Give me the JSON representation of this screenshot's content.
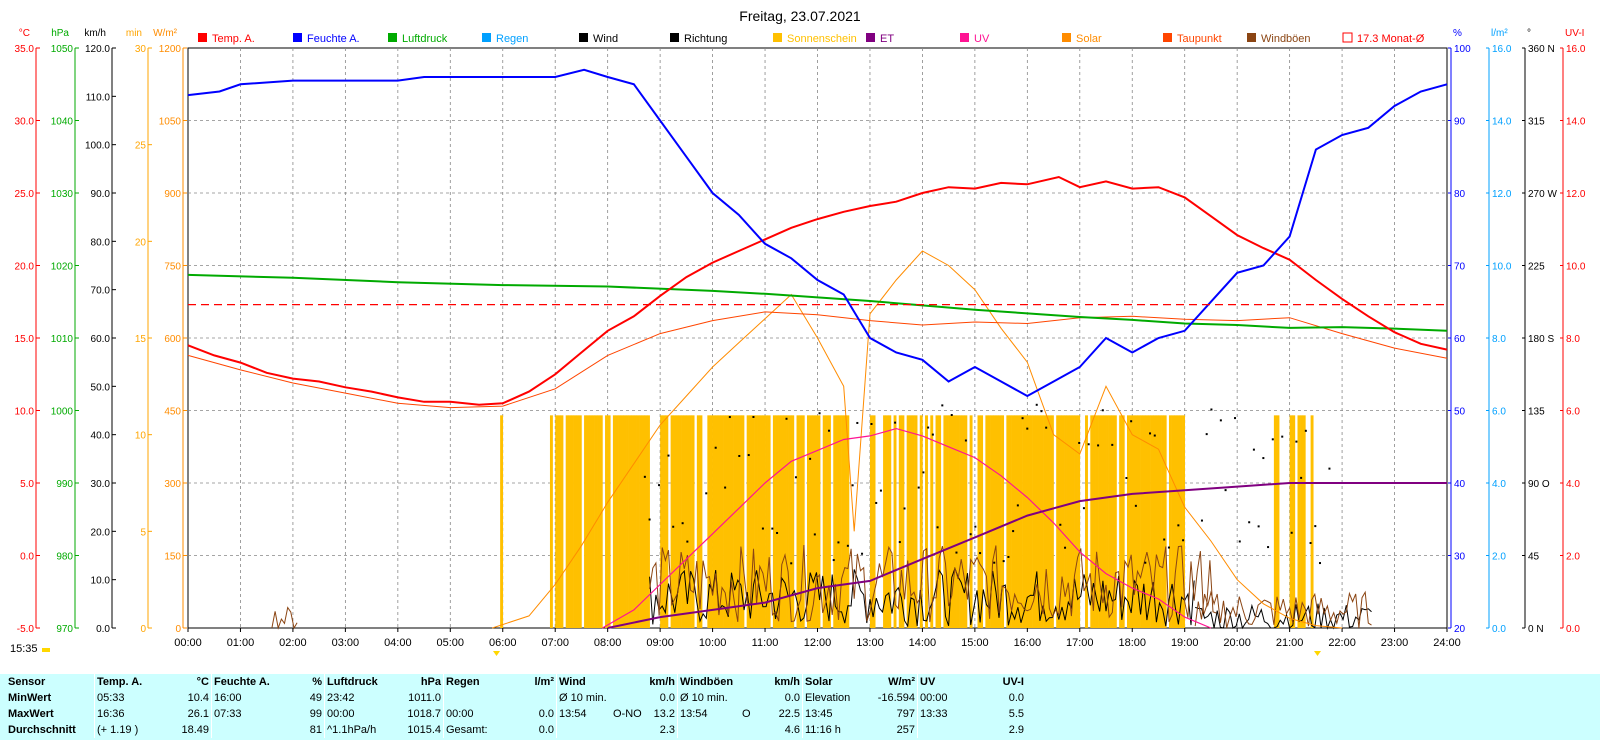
{
  "title": "Freitag, 23.07.2021",
  "current_time": "15:35",
  "legend": [
    {
      "label": "Temp. A.",
      "color": "#ff0000",
      "swatch": "fill"
    },
    {
      "label": "Feuchte A.",
      "color": "#0000ff",
      "swatch": "fill"
    },
    {
      "label": "Luftdruck",
      "color": "#00aa00",
      "swatch": "fill"
    },
    {
      "label": "Regen",
      "color": "#00a0ff",
      "swatch": "fill"
    },
    {
      "label": "Wind",
      "color": "#000000",
      "swatch": "fill"
    },
    {
      "label": "Richtung",
      "color": "#000000",
      "swatch": "fill"
    },
    {
      "label": "Sonnenschein",
      "color": "#ffc000",
      "swatch": "fill"
    },
    {
      "label": "ET",
      "color": "#800080",
      "swatch": "fill"
    },
    {
      "label": "UV",
      "color": "#ff1493",
      "swatch": "fill"
    },
    {
      "label": "Solar",
      "color": "#ff8c00",
      "swatch": "fill"
    },
    {
      "label": "Taupunkt",
      "color": "#ff4500",
      "swatch": "fill"
    },
    {
      "label": "Windböen",
      "color": "#8b4513",
      "swatch": "fill"
    },
    {
      "label": "17.3 Monat-Ø",
      "color": "#ff0000",
      "swatch": "outline"
    }
  ],
  "axes_left": [
    {
      "unit": "°C",
      "color": "#ff0000",
      "ticks": [
        "35.0",
        "30.0",
        "25.0",
        "20.0",
        "15.0",
        "10.0",
        "5.0",
        "0.0",
        "-5.0"
      ]
    },
    {
      "unit": "hPa",
      "color": "#00aa00",
      "ticks": [
        "1050",
        "1040",
        "1030",
        "1020",
        "1010",
        "1000",
        "990",
        "980",
        "970"
      ]
    },
    {
      "unit": "km/h",
      "color": "#000000",
      "ticks": [
        "120.0",
        "110.0",
        "100.0",
        "90.0",
        "80.0",
        "70.0",
        "60.0",
        "50.0",
        "40.0",
        "30.0",
        "20.0",
        "10.0",
        "0.0"
      ]
    },
    {
      "unit": "min",
      "color": "#ffa500",
      "ticks": [
        "30",
        "25",
        "20",
        "15",
        "10",
        "5",
        "0"
      ]
    },
    {
      "unit": "W/m²",
      "color": "#ff8c00",
      "ticks": [
        "1200",
        "1050",
        "900",
        "750",
        "600",
        "450",
        "300",
        "150",
        "0"
      ]
    }
  ],
  "axes_right": [
    {
      "unit": "%",
      "color": "#0000ff",
      "ticks": [
        "100",
        "90",
        "80",
        "70",
        "60",
        "50",
        "40",
        "30",
        "20"
      ]
    },
    {
      "unit": "l/m²",
      "color": "#00a0ff",
      "ticks": [
        "16.0",
        "14.0",
        "12.0",
        "10.0",
        "8.0",
        "6.0",
        "4.0",
        "2.0",
        "0.0"
      ]
    },
    {
      "unit": "°",
      "color": "#000000",
      "ticks": [
        "360 N",
        "315",
        "270 W",
        "225",
        "180 S",
        "135",
        "90 O",
        "45",
        "0 N"
      ]
    },
    {
      "unit": "UV-I",
      "color": "#ff0000",
      "ticks": [
        "16.0",
        "14.0",
        "12.0",
        "10.0",
        "8.0",
        "6.0",
        "4.0",
        "2.0",
        "0.0"
      ]
    }
  ],
  "chart_data": {
    "type": "line",
    "title": "Freitag, 23.07.2021",
    "x_ticks": [
      "00:00",
      "01:00",
      "02:00",
      "03:00",
      "04:00",
      "05:00",
      "06:00",
      "07:00",
      "08:00",
      "09:00",
      "10:00",
      "11:00",
      "12:00",
      "13:00",
      "14:00",
      "15:00",
      "16:00",
      "17:00",
      "18:00",
      "19:00",
      "20:00",
      "21:00",
      "22:00",
      "23:00",
      "24:00"
    ],
    "xlim_hours": [
      0,
      24
    ],
    "grid": true,
    "reference_line": {
      "name": "17.3 Monat-Ø",
      "value": 17.3,
      "unit": "°C",
      "color": "#ff0000"
    },
    "series": [
      {
        "name": "Temp. A.",
        "unit": "°C",
        "ylim": [
          -5,
          35
        ],
        "color": "#ff0000",
        "points": [
          [
            0,
            14.5
          ],
          [
            0.5,
            13.8
          ],
          [
            1,
            13.3
          ],
          [
            1.5,
            12.6
          ],
          [
            2,
            12.2
          ],
          [
            2.5,
            12.0
          ],
          [
            3,
            11.6
          ],
          [
            3.5,
            11.3
          ],
          [
            4,
            10.9
          ],
          [
            4.5,
            10.6
          ],
          [
            5,
            10.6
          ],
          [
            5.55,
            10.4
          ],
          [
            6,
            10.5
          ],
          [
            6.5,
            11.3
          ],
          [
            7,
            12.5
          ],
          [
            7.5,
            14.0
          ],
          [
            8,
            15.5
          ],
          [
            8.5,
            16.5
          ],
          [
            9,
            17.9
          ],
          [
            9.5,
            19.2
          ],
          [
            10,
            20.2
          ],
          [
            10.5,
            21.0
          ],
          [
            11,
            21.8
          ],
          [
            11.5,
            22.6
          ],
          [
            12,
            23.2
          ],
          [
            12.5,
            23.7
          ],
          [
            13,
            24.1
          ],
          [
            13.5,
            24.4
          ],
          [
            14,
            25.0
          ],
          [
            14.5,
            25.4
          ],
          [
            15,
            25.3
          ],
          [
            15.5,
            25.7
          ],
          [
            16,
            25.6
          ],
          [
            16.6,
            26.1
          ],
          [
            17,
            25.4
          ],
          [
            17.5,
            25.8
          ],
          [
            18,
            25.3
          ],
          [
            18.5,
            25.4
          ],
          [
            19,
            24.7
          ],
          [
            19.5,
            23.4
          ],
          [
            20,
            22.1
          ],
          [
            20.5,
            21.2
          ],
          [
            21,
            20.4
          ],
          [
            21.5,
            19.0
          ],
          [
            22,
            17.7
          ],
          [
            22.5,
            16.5
          ],
          [
            23,
            15.4
          ],
          [
            23.5,
            14.6
          ],
          [
            24,
            14.2
          ]
        ]
      },
      {
        "name": "Taupunkt",
        "unit": "°C",
        "ylim": [
          -5,
          35
        ],
        "color": "#ff4500",
        "points": [
          [
            0,
            13.8
          ],
          [
            1,
            12.8
          ],
          [
            2,
            11.9
          ],
          [
            3,
            11.2
          ],
          [
            4,
            10.5
          ],
          [
            5,
            10.2
          ],
          [
            6,
            10.3
          ],
          [
            7,
            11.5
          ],
          [
            8,
            13.8
          ],
          [
            9,
            15.3
          ],
          [
            10,
            16.2
          ],
          [
            11,
            16.8
          ],
          [
            12,
            16.6
          ],
          [
            13,
            16.2
          ],
          [
            14,
            15.9
          ],
          [
            15,
            16.1
          ],
          [
            16,
            16.0
          ],
          [
            17,
            16.4
          ],
          [
            18,
            16.5
          ],
          [
            19,
            16.3
          ],
          [
            20,
            16.2
          ],
          [
            21,
            16.4
          ],
          [
            22,
            15.3
          ],
          [
            23,
            14.3
          ],
          [
            24,
            13.6
          ]
        ]
      },
      {
        "name": "Feuchte A.",
        "unit": "%",
        "ylim": [
          20,
          100
        ],
        "color": "#0000ff",
        "points": [
          [
            0,
            93.5
          ],
          [
            0.6,
            94
          ],
          [
            1,
            95
          ],
          [
            2,
            95.5
          ],
          [
            3,
            95.5
          ],
          [
            4,
            95.5
          ],
          [
            4.5,
            96
          ],
          [
            5,
            96
          ],
          [
            6,
            96
          ],
          [
            7,
            96
          ],
          [
            7.55,
            97
          ],
          [
            8,
            96
          ],
          [
            8.5,
            95
          ],
          [
            9,
            90
          ],
          [
            9.5,
            85
          ],
          [
            10,
            80
          ],
          [
            10.5,
            77
          ],
          [
            11,
            73
          ],
          [
            11.5,
            71
          ],
          [
            12,
            68
          ],
          [
            12.5,
            66
          ],
          [
            13,
            60
          ],
          [
            13.5,
            58
          ],
          [
            14,
            57
          ],
          [
            14.5,
            54
          ],
          [
            15,
            56
          ],
          [
            15.5,
            54
          ],
          [
            16,
            52
          ],
          [
            16.5,
            54
          ],
          [
            17,
            56
          ],
          [
            17.5,
            60
          ],
          [
            18,
            58
          ],
          [
            18.5,
            60
          ],
          [
            19,
            61
          ],
          [
            19.5,
            65
          ],
          [
            20,
            69
          ],
          [
            20.5,
            70
          ],
          [
            21,
            74
          ],
          [
            21.5,
            86
          ],
          [
            22,
            88
          ],
          [
            22.5,
            89
          ],
          [
            23,
            92
          ],
          [
            23.5,
            94
          ],
          [
            24,
            95
          ]
        ]
      },
      {
        "name": "Luftdruck",
        "unit": "hPa",
        "ylim": [
          970,
          1050
        ],
        "color": "#00aa00",
        "points": [
          [
            0,
            1018.7
          ],
          [
            2,
            1018.3
          ],
          [
            4,
            1017.7
          ],
          [
            6,
            1017.3
          ],
          [
            8,
            1017.1
          ],
          [
            10,
            1016.5
          ],
          [
            11,
            1016.1
          ],
          [
            12,
            1015.6
          ],
          [
            13,
            1015.1
          ],
          [
            14,
            1014.5
          ],
          [
            15,
            1013.9
          ],
          [
            16,
            1013.4
          ],
          [
            17,
            1012.9
          ],
          [
            18,
            1012.5
          ],
          [
            19,
            1012.0
          ],
          [
            20,
            1011.8
          ],
          [
            21,
            1011.4
          ],
          [
            22,
            1011.5
          ],
          [
            23,
            1011.3
          ],
          [
            24,
            1011.0
          ]
        ]
      },
      {
        "name": "Solar",
        "unit": "W/m²",
        "ylim": [
          0,
          1200
        ],
        "color": "#ff8c00",
        "points": [
          [
            5.8,
            0
          ],
          [
            6.5,
            25
          ],
          [
            7,
            90
          ],
          [
            7.5,
            170
          ],
          [
            8,
            260
          ],
          [
            8.5,
            340
          ],
          [
            9,
            420
          ],
          [
            9.5,
            480
          ],
          [
            10,
            540
          ],
          [
            10.5,
            590
          ],
          [
            11,
            640
          ],
          [
            11.5,
            690
          ],
          [
            12,
            600
          ],
          [
            12.5,
            500
          ],
          [
            12.7,
            200
          ],
          [
            13,
            650
          ],
          [
            13.5,
            720
          ],
          [
            14,
            780
          ],
          [
            14.5,
            750
          ],
          [
            15,
            700
          ],
          [
            15.5,
            620
          ],
          [
            16,
            550
          ],
          [
            16.5,
            400
          ],
          [
            17,
            360
          ],
          [
            17.5,
            500
          ],
          [
            18,
            400
          ],
          [
            18.5,
            370
          ],
          [
            19,
            250
          ],
          [
            19.5,
            180
          ],
          [
            20,
            100
          ],
          [
            20.5,
            50
          ],
          [
            21,
            20
          ],
          [
            21.5,
            5
          ],
          [
            22,
            0
          ]
        ]
      },
      {
        "name": "UV",
        "unit": "UV-I",
        "ylim": [
          0,
          16
        ],
        "color": "#ff1493",
        "points": [
          [
            7.9,
            0
          ],
          [
            8.5,
            0.5
          ],
          [
            9,
            1.2
          ],
          [
            9.5,
            1.9
          ],
          [
            10,
            2.6
          ],
          [
            10.5,
            3.3
          ],
          [
            11,
            4.0
          ],
          [
            11.5,
            4.6
          ],
          [
            12,
            4.9
          ],
          [
            12.5,
            5.2
          ],
          [
            13,
            5.3
          ],
          [
            13.5,
            5.5
          ],
          [
            14,
            5.3
          ],
          [
            14.5,
            5.0
          ],
          [
            15,
            4.7
          ],
          [
            15.5,
            4.2
          ],
          [
            16,
            3.6
          ],
          [
            16.5,
            2.9
          ],
          [
            17,
            2.1
          ],
          [
            17.5,
            1.5
          ],
          [
            18,
            1.1
          ],
          [
            18.5,
            0.8
          ],
          [
            19,
            0.3
          ],
          [
            19.5,
            0
          ]
        ]
      },
      {
        "name": "ET",
        "unit": "l/m²",
        "ylim": [
          0,
          16
        ],
        "color": "#800080",
        "points": [
          [
            8,
            0
          ],
          [
            9,
            0.3
          ],
          [
            10,
            0.5
          ],
          [
            11,
            0.7
          ],
          [
            12,
            1.1
          ],
          [
            13,
            1.3
          ],
          [
            14,
            1.9
          ],
          [
            15,
            2.5
          ],
          [
            16,
            3.1
          ],
          [
            17,
            3.5
          ],
          [
            18,
            3.7
          ],
          [
            19,
            3.8
          ],
          [
            20,
            3.9
          ],
          [
            21,
            4.0
          ],
          [
            22,
            4.0
          ],
          [
            24,
            4.0
          ]
        ]
      }
    ]
  },
  "stats": {
    "headers": {
      "sensor": "Sensor",
      "temp": "Temp. A.",
      "temp_unit": "°C",
      "feuchte": "Feuchte A.",
      "feuchte_unit": "%",
      "luftdruck": "Luftdruck",
      "luftdruck_unit": "hPa",
      "regen": "Regen",
      "regen_unit": "l/m²",
      "wind": "Wind",
      "wind_unit": "km/h",
      "boeen": "Windböen",
      "boeen_unit": "km/h",
      "solar": "Solar",
      "solar_unit": "W/m²",
      "uv": "UV",
      "uv_unit": "UV-I"
    },
    "rows": {
      "min": {
        "label": "MinWert",
        "temp_time": "05:33",
        "temp_val": "10.4",
        "feuchte_time": "16:00",
        "feuchte_val": "49",
        "luft_time": "23:42",
        "luft_val": "1011.0",
        "regen_time": "",
        "regen_val": "",
        "wind_time": "Ø 10 min.",
        "wind_dir": "",
        "wind_val": "0.0",
        "boeen_time": "Ø 10 min.",
        "boeen_dir": "",
        "boeen_val": "0.0",
        "solar_time": "Elevation",
        "solar_val": "-16.594",
        "uv_time": "00:00",
        "uv_val": "0.0"
      },
      "max": {
        "label": "MaxWert",
        "temp_time": "16:36",
        "temp_val": "26.1",
        "feuchte_time": "07:33",
        "feuchte_val": "99",
        "luft_time": "00:00",
        "luft_val": "1018.7",
        "regen_time": "00:00",
        "regen_val": "0.0",
        "wind_time": "13:54",
        "wind_dir": "O-NO",
        "wind_val": "13.2",
        "boeen_time": "13:54",
        "boeen_dir": "O",
        "boeen_val": "22.5",
        "solar_time": "13:45",
        "solar_val": "797",
        "uv_time": "13:33",
        "uv_val": "5.5"
      },
      "avg": {
        "label": "Durchschnitt",
        "temp_time": "(+ 1.19 )",
        "temp_val": "18.49",
        "feuchte_time": "",
        "feuchte_val": "81",
        "luft_time": "^1.1hPa/h",
        "luft_val": "1015.4",
        "regen_time": "Gesamt:",
        "regen_val": "0.0",
        "wind_time": "",
        "wind_dir": "",
        "wind_val": "2.3",
        "boeen_time": "",
        "boeen_dir": "",
        "boeen_val": "4.6",
        "solar_time": "11:16 h",
        "solar_val": "257",
        "uv_time": "",
        "uv_val": "2.9"
      }
    }
  }
}
